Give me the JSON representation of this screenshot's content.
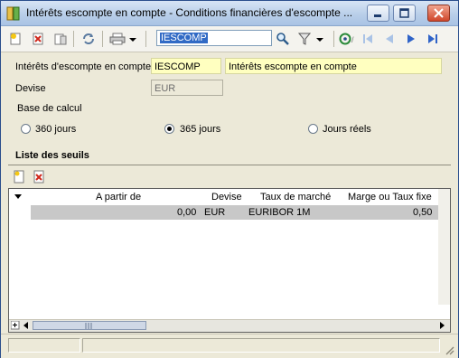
{
  "window": {
    "title": "Intérêts escompte en compte -  Conditions financières d'escompte ..."
  },
  "toolbar": {
    "search_value": "IESCOMP"
  },
  "form": {
    "name_label": "Intérêts d'escompte en compte",
    "code_value": "IESCOMP",
    "description_value": "Intérêts escompte en compte",
    "currency_label": "Devise",
    "currency_value": "EUR",
    "basis_label": "Base de calcul",
    "basis_options": [
      {
        "label": "360 jours",
        "selected": false
      },
      {
        "label": "365 jours",
        "selected": true
      },
      {
        "label": "Jours réels",
        "selected": false
      }
    ]
  },
  "thresholds": {
    "title": "Liste des seuils",
    "columns": [
      "A partir de",
      "Devise",
      "Taux de marché",
      "Marge ou Taux fixe"
    ],
    "rows": [
      {
        "from": "0,00",
        "currency": "EUR",
        "market_rate": "EURIBOR 1M",
        "margin": "0,50"
      }
    ]
  }
}
